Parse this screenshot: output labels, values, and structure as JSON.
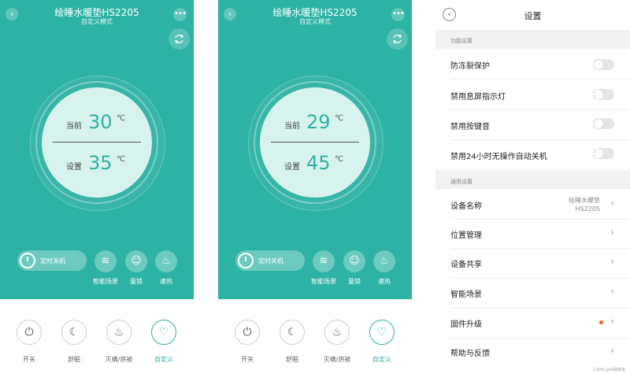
{
  "phones": [
    {
      "title": "绘睡水暖垫HS2205",
      "subtitle": "自定义模式",
      "current_label": "当前",
      "current_temp": "30",
      "set_label": "设置",
      "set_temp": "35",
      "unit": "℃",
      "timer_label": "定时关机",
      "round_buttons": [
        "智能场景",
        "童锁",
        "速热"
      ],
      "bottom_buttons": [
        "开关",
        "舒眠",
        "灭螨/烘被",
        "自定义"
      ]
    },
    {
      "title": "绘睡水暖垫HS2205",
      "subtitle": "自定义模式",
      "current_label": "当前",
      "current_temp": "29",
      "set_label": "设置",
      "set_temp": "45",
      "unit": "℃",
      "timer_label": "定时关机",
      "round_buttons": [
        "智能场景",
        "童锁",
        "速热"
      ],
      "bottom_buttons": [
        "开关",
        "舒眠",
        "灭螨/烘被",
        "自定义"
      ]
    }
  ],
  "settings": {
    "title": "设置",
    "section1": "功能设置",
    "toggles": [
      "防冻裂保护",
      "禁用息屏指示灯",
      "禁用按键音",
      "禁用24小时无操作自动关机"
    ],
    "section2": "通用设置",
    "device_name_label": "设备名称",
    "device_name_value_1": "绘睡水暖垫",
    "device_name_value_2": "HS2205",
    "rows": [
      "位置管理",
      "设备共享",
      "智能场景",
      "固件升级",
      "帮助与反馈"
    ],
    "watermark": "CSDN @绘睡暖垫"
  },
  "colors": {
    "accent": "#2db3a3",
    "update_dot": "#f06020"
  }
}
